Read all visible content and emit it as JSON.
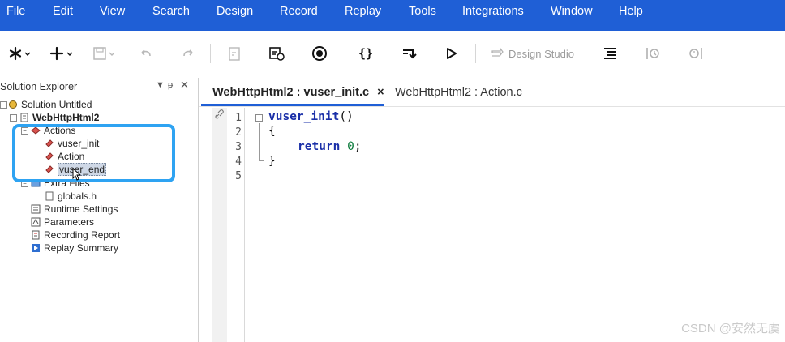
{
  "menu": [
    "File",
    "Edit",
    "View",
    "Search",
    "Design",
    "Record",
    "Replay",
    "Tools",
    "Integrations",
    "Window",
    "Help"
  ],
  "toolbar": {
    "design_studio_label": "Design Studio",
    "icons": [
      "asterisk-dropdown",
      "plus-dropdown",
      "save-dropdown",
      "undo",
      "redo",
      "script-file",
      "checkpoint",
      "record",
      "braces",
      "step",
      "play",
      "design-studio",
      "list",
      "replay-log",
      "replay-summary"
    ]
  },
  "explorer": {
    "title": "Solution Explorer",
    "pin_glyph": "▾ ᵽ ✕",
    "solution_label": "Solution Untitled",
    "script_label": "WebHttpHtml2",
    "actions_label": "Actions",
    "action_items": [
      "vuser_init",
      "Action",
      "vuser_end"
    ],
    "extra_files_label": "Extra Files",
    "extra_files_items": [
      "globals.h"
    ],
    "other_items": [
      "Runtime Settings",
      "Parameters",
      "Recording Report",
      "Replay Summary"
    ]
  },
  "editor": {
    "active_tab": "WebHttpHtml2 : vuser_init.c",
    "active_tab_close": "×",
    "other_tab": "WebHttpHtml2 : Action.c",
    "line_numbers": [
      "1",
      "2",
      "3",
      "4",
      "5"
    ],
    "code": {
      "fn_name": "vuser_init",
      "fn_parens": "()",
      "open_brace": "{",
      "return_kw": "return",
      "return_val": "0",
      "semicolon": ";",
      "close_brace": "}"
    }
  },
  "watermark": "CSDN @安然无虞",
  "colors": {
    "menubar": "#1f5fd6",
    "highlight": "#2ea3f2",
    "tab_underline": "#1f5fd6"
  }
}
